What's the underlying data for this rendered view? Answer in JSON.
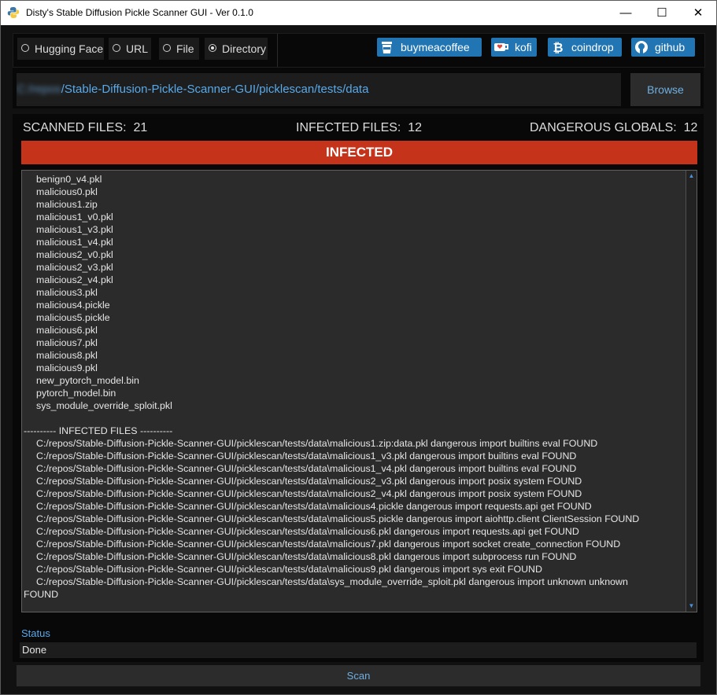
{
  "window": {
    "title": "Disty's Stable Diffusion Pickle Scanner GUI - Ver 0.1.0",
    "minimize_glyph": "—",
    "maximize_glyph": "☐",
    "close_glyph": "✕"
  },
  "source_options": [
    {
      "label": "Hugging Face",
      "selected": false
    },
    {
      "label": "URL",
      "selected": false
    },
    {
      "label": "File",
      "selected": false
    },
    {
      "label": "Directory",
      "selected": true
    }
  ],
  "links": [
    {
      "label": "buymeacoffee",
      "icon": "coffee-cup-icon"
    },
    {
      "label": "kofi",
      "icon": "kofi-cup-icon"
    },
    {
      "label": "coindrop",
      "icon": "bitcoin-icon"
    },
    {
      "label": "github",
      "icon": "github-icon"
    }
  ],
  "path": {
    "blurred_prefix": "C:/repos",
    "value": "/Stable-Diffusion-Pickle-Scanner-GUI/picklescan/tests/data"
  },
  "browse_label": "Browse",
  "stats": {
    "scanned_label": "SCANNED FILES:",
    "scanned_count": "21",
    "infected_label": "INFECTED FILES:",
    "infected_count": "12",
    "globals_label": "DANGEROUS GLOBALS:",
    "globals_count": "12"
  },
  "banner": "INFECTED",
  "output_lines": [
    {
      "text": "benign0_v4.pkl",
      "flush": false
    },
    {
      "text": "malicious0.pkl",
      "flush": false
    },
    {
      "text": "malicious1.zip",
      "flush": false
    },
    {
      "text": "malicious1_v0.pkl",
      "flush": false
    },
    {
      "text": "malicious1_v3.pkl",
      "flush": false
    },
    {
      "text": "malicious1_v4.pkl",
      "flush": false
    },
    {
      "text": "malicious2_v0.pkl",
      "flush": false
    },
    {
      "text": "malicious2_v3.pkl",
      "flush": false
    },
    {
      "text": "malicious2_v4.pkl",
      "flush": false
    },
    {
      "text": "malicious3.pkl",
      "flush": false
    },
    {
      "text": "malicious4.pickle",
      "flush": false
    },
    {
      "text": "malicious5.pickle",
      "flush": false
    },
    {
      "text": "malicious6.pkl",
      "flush": false
    },
    {
      "text": "malicious7.pkl",
      "flush": false
    },
    {
      "text": "malicious8.pkl",
      "flush": false
    },
    {
      "text": "malicious9.pkl",
      "flush": false
    },
    {
      "text": "new_pytorch_model.bin",
      "flush": false
    },
    {
      "text": "pytorch_model.bin",
      "flush": false
    },
    {
      "text": "sys_module_override_sploit.pkl",
      "flush": false
    },
    {
      "text": "",
      "flush": true
    },
    {
      "text": "---------- INFECTED FILES ----------",
      "flush": true
    },
    {
      "text": "C:/repos/Stable-Diffusion-Pickle-Scanner-GUI/picklescan/tests/data\\malicious1.zip:data.pkl dangerous import builtins eval FOUND",
      "flush": false
    },
    {
      "text": "C:/repos/Stable-Diffusion-Pickle-Scanner-GUI/picklescan/tests/data\\malicious1_v3.pkl dangerous import builtins eval FOUND",
      "flush": false
    },
    {
      "text": "C:/repos/Stable-Diffusion-Pickle-Scanner-GUI/picklescan/tests/data\\malicious1_v4.pkl dangerous import builtins eval FOUND",
      "flush": false
    },
    {
      "text": "C:/repos/Stable-Diffusion-Pickle-Scanner-GUI/picklescan/tests/data\\malicious2_v3.pkl dangerous import posix system FOUND",
      "flush": false
    },
    {
      "text": "C:/repos/Stable-Diffusion-Pickle-Scanner-GUI/picklescan/tests/data\\malicious2_v4.pkl dangerous import posix system FOUND",
      "flush": false
    },
    {
      "text": "C:/repos/Stable-Diffusion-Pickle-Scanner-GUI/picklescan/tests/data\\malicious4.pickle dangerous import requests.api get FOUND",
      "flush": false
    },
    {
      "text": "C:/repos/Stable-Diffusion-Pickle-Scanner-GUI/picklescan/tests/data\\malicious5.pickle dangerous import aiohttp.client ClientSession FOUND",
      "flush": false
    },
    {
      "text": "C:/repos/Stable-Diffusion-Pickle-Scanner-GUI/picklescan/tests/data\\malicious6.pkl dangerous import requests.api get FOUND",
      "flush": false
    },
    {
      "text": "C:/repos/Stable-Diffusion-Pickle-Scanner-GUI/picklescan/tests/data\\malicious7.pkl dangerous import socket create_connection FOUND",
      "flush": false
    },
    {
      "text": "C:/repos/Stable-Diffusion-Pickle-Scanner-GUI/picklescan/tests/data\\malicious8.pkl dangerous import subprocess run FOUND",
      "flush": false
    },
    {
      "text": "C:/repos/Stable-Diffusion-Pickle-Scanner-GUI/picklescan/tests/data\\malicious9.pkl dangerous import sys exit FOUND",
      "flush": false
    },
    {
      "text": "C:/repos/Stable-Diffusion-Pickle-Scanner-GUI/picklescan/tests/data\\sys_module_override_sploit.pkl dangerous import unknown unknown",
      "flush": false
    },
    {
      "text": "FOUND",
      "flush": true
    }
  ],
  "status": {
    "label": "Status",
    "value": "Done"
  },
  "scan_label": "Scan",
  "colors": {
    "banner": "#c5341a",
    "link_button": "#2275b3",
    "accent_text": "#5aa9e8"
  }
}
